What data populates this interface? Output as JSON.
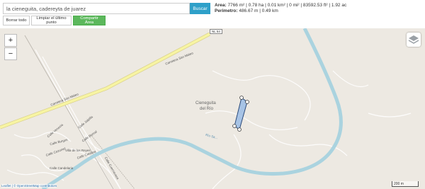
{
  "search": {
    "value": "la cieneguita, cadereyta de juarez",
    "button": "Buscar"
  },
  "stats": {
    "area_label": "Area:",
    "area_value": "7766 m² | 0.78 ha | 0.01 km² | 0 mi² | 83592.53 ft² | 1.92 ac",
    "perimeter_label": "Perimetro:",
    "perimeter_value": "486.67 m | 0.49 km"
  },
  "buttons": {
    "clear_all": "Borrar todo",
    "clear_last": "Limpiar el último punto",
    "share": "Compartir Área"
  },
  "map": {
    "zoom_in": "+",
    "zoom_out": "−",
    "place_label_1": "Cieneguita",
    "place_label_2": "del Río",
    "road_label": "Carretera San Mateo",
    "road_label_2": "Carretera San Mateo",
    "route_badge": "NL 54",
    "river_label": "Río Sa...",
    "street_labels": [
      "Calle Venecia",
      "Calle Jalpilla",
      "Calle Boreal",
      "Calle Burgos",
      "Calle Cozumel",
      "Villa de los Reyes",
      "Calle Catalina",
      "Calle Candelaria",
      "Calle Cuernavaca"
    ],
    "scale": "200 m",
    "attribution": "Leaflet | © OpenStreetMap contributors",
    "colors": {
      "river": "#aad3df",
      "road_yellow": "#f7f4a3",
      "polygon_fill": "#8fb5e5",
      "polygon_stroke": "#2b4a7a"
    }
  }
}
